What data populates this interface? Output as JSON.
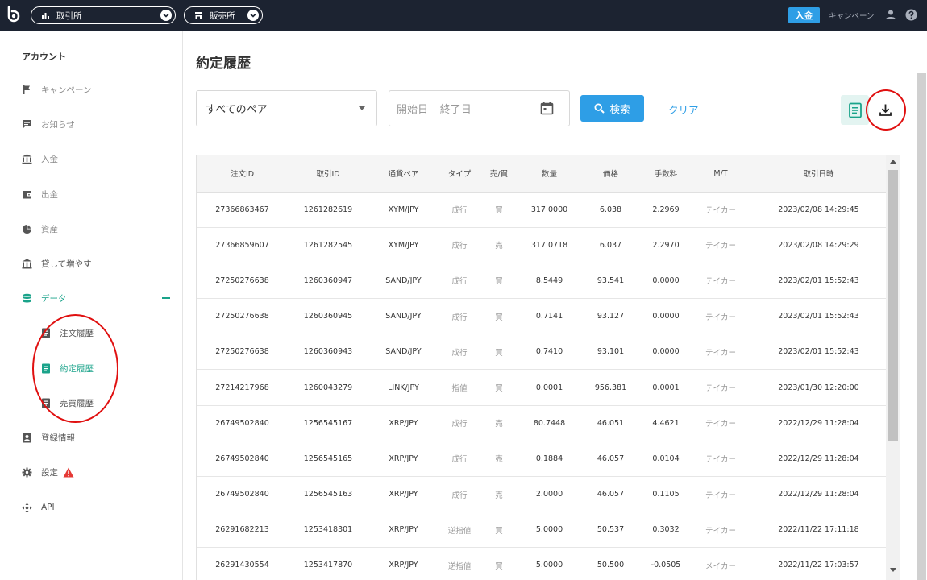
{
  "topbar": {
    "exchange_label": "取引所",
    "shop_label": "販売所",
    "deposit_label": "入金",
    "campaign_label": "キャンペーン"
  },
  "sidebar": {
    "title": "アカウント",
    "items": [
      {
        "label": "キャンペーン",
        "icon": "flag-icon"
      },
      {
        "label": "お知らせ",
        "icon": "message-icon"
      },
      {
        "label": "入金",
        "icon": "bank-icon"
      },
      {
        "label": "出金",
        "icon": "wallet-icon"
      },
      {
        "label": "資産",
        "icon": "pie-chart-icon"
      },
      {
        "label": "貸して増やす",
        "icon": "bank-icon"
      },
      {
        "label": "データ",
        "icon": "database-icon"
      },
      {
        "label": "登録情報",
        "icon": "contact-card-icon"
      },
      {
        "label": "設定",
        "icon": "gear-icon"
      },
      {
        "label": "API",
        "icon": "api-icon"
      }
    ],
    "data_subitems": [
      {
        "label": "注文履歴"
      },
      {
        "label": "約定履歴"
      },
      {
        "label": "売買履歴"
      }
    ]
  },
  "main": {
    "title": "約定履歴",
    "pair_select_value": "すべてのペア",
    "date_range_placeholder": "開始日 – 終了日",
    "search_label": "検索",
    "clear_label": "クリア"
  },
  "table": {
    "columns": [
      "注文ID",
      "取引ID",
      "通貨ペア",
      "タイプ",
      "売/買",
      "数量",
      "価格",
      "手数料",
      "M/T",
      "取引日時"
    ],
    "rows": [
      [
        "27366863467",
        "1261282619",
        "XYM/JPY",
        "成行",
        "買",
        "317.0000",
        "6.038",
        "2.2969",
        "テイカー",
        "2023/02/08 14:29:45"
      ],
      [
        "27366859607",
        "1261282545",
        "XYM/JPY",
        "成行",
        "売",
        "317.0718",
        "6.037",
        "2.2970",
        "テイカー",
        "2023/02/08 14:29:29"
      ],
      [
        "27250276638",
        "1260360947",
        "SAND/JPY",
        "成行",
        "買",
        "8.5449",
        "93.541",
        "0.0000",
        "テイカー",
        "2023/02/01 15:52:43"
      ],
      [
        "27250276638",
        "1260360945",
        "SAND/JPY",
        "成行",
        "買",
        "0.7141",
        "93.127",
        "0.0000",
        "テイカー",
        "2023/02/01 15:52:43"
      ],
      [
        "27250276638",
        "1260360943",
        "SAND/JPY",
        "成行",
        "買",
        "0.7410",
        "93.101",
        "0.0000",
        "テイカー",
        "2023/02/01 15:52:43"
      ],
      [
        "27214217968",
        "1260043279",
        "LINK/JPY",
        "指値",
        "買",
        "0.0001",
        "956.381",
        "0.0001",
        "テイカー",
        "2023/01/30 12:20:00"
      ],
      [
        "26749502840",
        "1256545167",
        "XRP/JPY",
        "成行",
        "売",
        "80.7448",
        "46.051",
        "4.4621",
        "テイカー",
        "2022/12/29 11:28:04"
      ],
      [
        "26749502840",
        "1256545165",
        "XRP/JPY",
        "成行",
        "売",
        "0.1884",
        "46.057",
        "0.0104",
        "テイカー",
        "2022/12/29 11:28:04"
      ],
      [
        "26749502840",
        "1256545163",
        "XRP/JPY",
        "成行",
        "売",
        "2.0000",
        "46.057",
        "0.1105",
        "テイカー",
        "2022/12/29 11:28:04"
      ],
      [
        "26291682213",
        "1253418301",
        "XRP/JPY",
        "逆指値",
        "買",
        "5.0000",
        "50.537",
        "0.3032",
        "テイカー",
        "2022/11/22 17:11:18"
      ],
      [
        "26291430554",
        "1253417870",
        "XRP/JPY",
        "逆指値",
        "買",
        "5.0000",
        "50.500",
        "-0.0505",
        "メイカー",
        "2022/11/22 17:03:57"
      ]
    ]
  },
  "colors": {
    "topbar_bg": "#1c2331",
    "accent_blue": "#2e9ee6",
    "accent_green": "#1aa38a",
    "annotation_red": "#e01010"
  }
}
